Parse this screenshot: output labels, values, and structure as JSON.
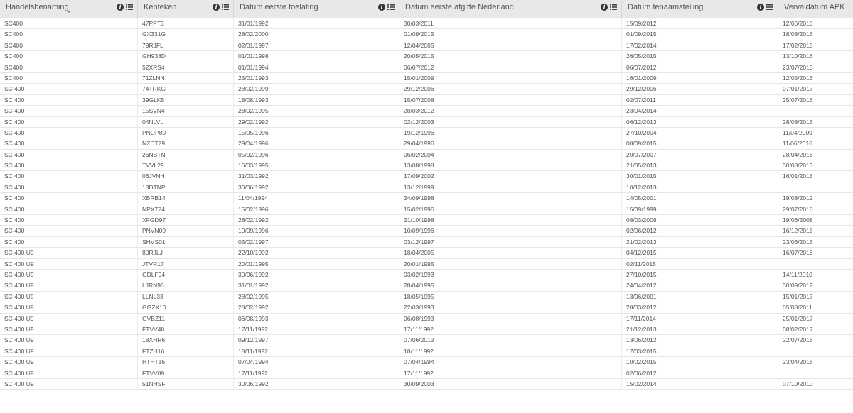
{
  "columns": [
    {
      "label": "Handelsbenaming"
    },
    {
      "label": "Kenteken"
    },
    {
      "label": "Datum eerste toelating"
    },
    {
      "label": "Datum eerste afgifte Nederland"
    },
    {
      "label": "Datum tenaamstelling"
    },
    {
      "label": "Vervaldatum APK"
    }
  ],
  "sort_indicator": "^",
  "rows": [
    [
      "SC400",
      "47PPT3",
      "31/01/1992",
      "30/03/2011",
      "15/09/2012",
      "12/06/2016"
    ],
    [
      "SC400",
      "GX331G",
      "28/02/2000",
      "01/09/2015",
      "01/09/2015",
      "18/08/2016"
    ],
    [
      "SC400",
      "79RJFL",
      "02/01/1997",
      "12/04/2005",
      "17/02/2014",
      "17/02/2015"
    ],
    [
      "SC400",
      "GH938D",
      "01/01/1998",
      "20/05/2015",
      "26/05/2015",
      "13/10/2016"
    ],
    [
      "SC400",
      "52XRS4",
      "01/01/1994",
      "06/07/2012",
      "06/07/2012",
      "23/07/2013"
    ],
    [
      "SC400",
      "71ZLNN",
      "25/01/1993",
      "15/01/2009",
      "16/01/2009",
      "12/05/2016"
    ],
    [
      "SC 400",
      "74TRKG",
      "28/02/1999",
      "29/12/2006",
      "29/12/2006",
      "07/01/2017"
    ],
    [
      "SC 400",
      "39GLK5",
      "18/08/1993",
      "15/07/2008",
      "02/07/2011",
      "25/07/2016"
    ],
    [
      "SC 400",
      "15SVN4",
      "28/02/1995",
      "28/03/2012",
      "23/04/2014",
      ""
    ],
    [
      "SC 400",
      "04NLVL",
      "29/02/1992",
      "02/12/2003",
      "06/12/2013",
      "28/08/2016"
    ],
    [
      "SC 400",
      "PNDP80",
      "15/05/1996",
      "19/12/1996",
      "27/10/2004",
      "11/04/2009"
    ],
    [
      "SC 400",
      "NZDT29",
      "29/04/1996",
      "29/04/1996",
      "08/09/2015",
      "11/06/2016"
    ],
    [
      "SC 400",
      "26NSTN",
      "05/02/1996",
      "06/02/2004",
      "20/07/2007",
      "28/04/2016"
    ],
    [
      "SC 400",
      "TVVL29",
      "16/03/1995",
      "13/08/1998",
      "21/05/2013",
      "30/08/2013"
    ],
    [
      "SC 400",
      "06JVNH",
      "31/03/1992",
      "17/09/2002",
      "30/01/2015",
      "16/01/2015"
    ],
    [
      "SC 400",
      "13DTNP",
      "30/06/1992",
      "13/12/1999",
      "10/12/2013",
      ""
    ],
    [
      "SC 400",
      "XBRB14",
      "11/04/1994",
      "24/09/1998",
      "14/05/2001",
      "19/08/2012"
    ],
    [
      "SC 400",
      "NPXT74",
      "15/02/1996",
      "15/02/1996",
      "15/09/1999",
      "29/07/2016"
    ],
    [
      "SC 400",
      "XFGD97",
      "28/02/1992",
      "21/10/1998",
      "08/03/2008",
      "19/06/2008"
    ],
    [
      "SC 400",
      "PNVN09",
      "10/09/1996",
      "10/09/1996",
      "02/06/2012",
      "16/12/2016"
    ],
    [
      "SC 400",
      "SHVS01",
      "05/02/1997",
      "03/12/1997",
      "21/02/2013",
      "23/06/2016"
    ],
    [
      "SC 400 U9",
      "80RJLJ",
      "22/10/1992",
      "18/04/2005",
      "04/12/2015",
      "16/07/2016"
    ],
    [
      "SC 400 U9",
      "JTVR17",
      "20/01/1995",
      "20/01/1995",
      "02/11/2015",
      ""
    ],
    [
      "SC 400 U9",
      "GDLF94",
      "30/06/1992",
      "03/02/1993",
      "27/10/2015",
      "14/11/2010"
    ],
    [
      "SC 400 U9",
      "LJRN96",
      "31/01/1992",
      "28/04/1995",
      "24/04/2012",
      "30/09/2012"
    ],
    [
      "SC 400 U9",
      "LLNL33",
      "28/02/1995",
      "18/05/1995",
      "13/06/2001",
      "15/01/2017"
    ],
    [
      "SC 400 U9",
      "GGZX10",
      "28/02/1992",
      "22/03/1993",
      "28/03/2012",
      "05/08/2011"
    ],
    [
      "SC 400 U9",
      "GVBZ11",
      "06/08/1993",
      "06/08/1993",
      "17/11/2014",
      "25/01/2017"
    ],
    [
      "SC 400 U9",
      "FTVV48",
      "17/11/1992",
      "17/11/1992",
      "21/12/2013",
      "08/02/2017"
    ],
    [
      "SC 400 U9",
      "18XHR6",
      "09/12/1997",
      "07/06/2012",
      "13/06/2012",
      "22/07/2016"
    ],
    [
      "SC 400 U9",
      "FTZH16",
      "18/11/1992",
      "18/11/1992",
      "17/03/2015",
      ""
    ],
    [
      "SC 400 U9",
      "HTHT16",
      "07/04/1994",
      "07/04/1994",
      "10/02/2015",
      "23/04/2016"
    ],
    [
      "SC 400 U9",
      "FTVV89",
      "17/11/1992",
      "17/11/1992",
      "02/06/2012",
      ""
    ],
    [
      "SC 400 U9",
      "51NHSF",
      "30/06/1992",
      "30/09/2003",
      "15/02/2014",
      "07/10/2010"
    ]
  ]
}
